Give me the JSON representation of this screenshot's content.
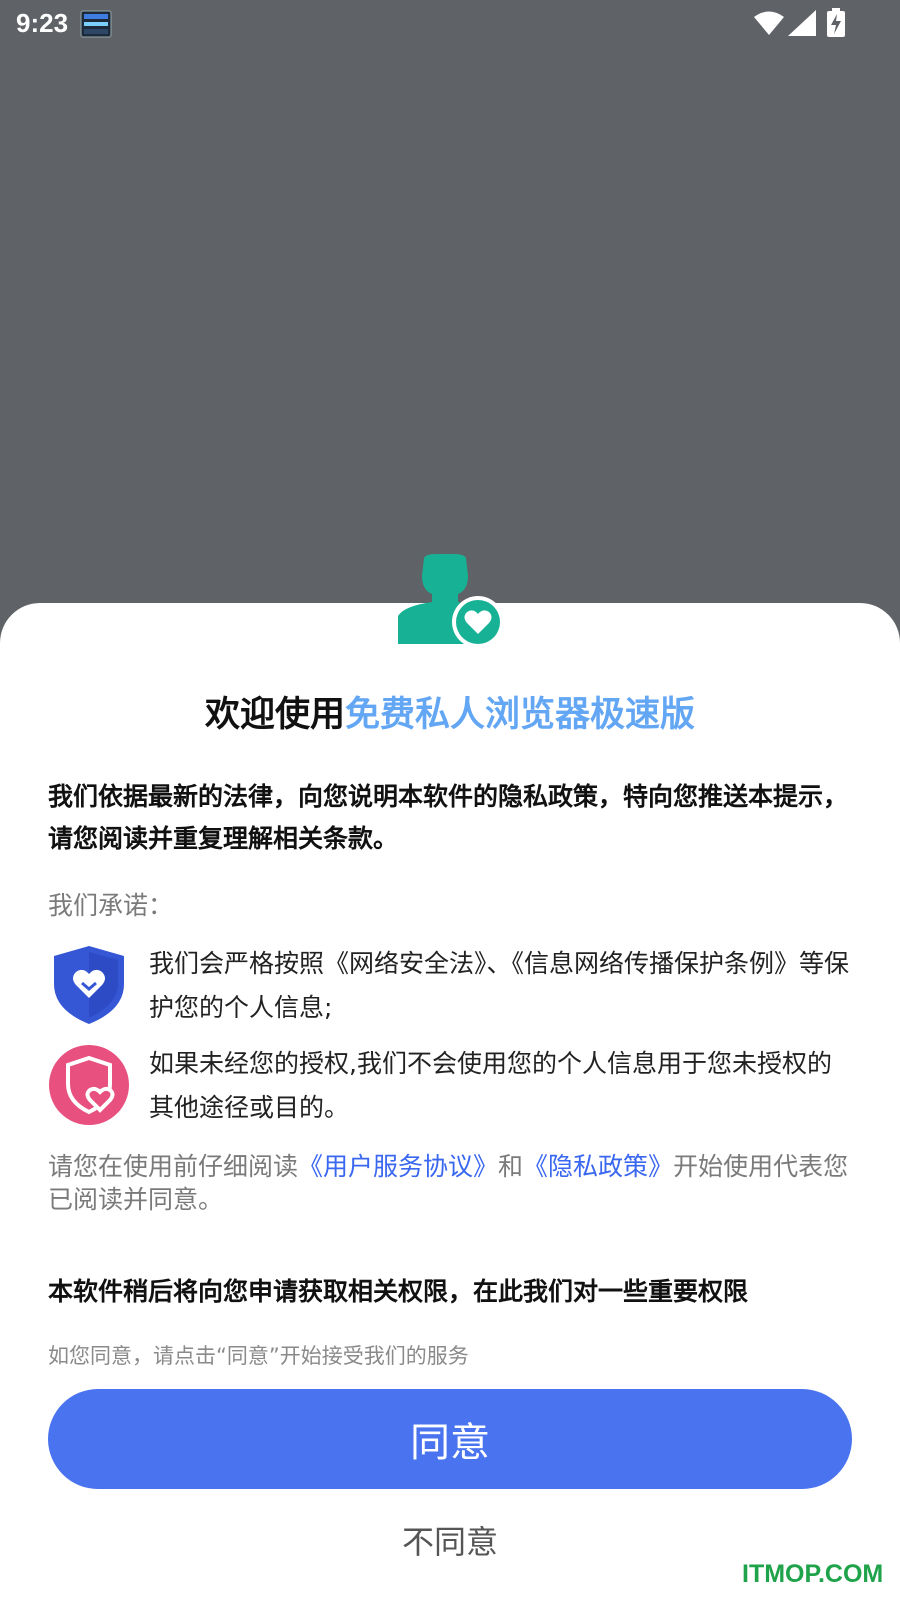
{
  "status_bar": {
    "time": "9:23"
  },
  "dialog": {
    "title_prefix": "欢迎使用",
    "title_app_name": "免费私人浏览器极速版",
    "intro": "我们依据最新的法律，向您说明本软件的隐私政策，特向您推送本提示，请您阅读并重复理解相关条款。",
    "promise_label": "我们承诺：",
    "promises": [
      {
        "icon": "shield-heart-icon",
        "text": "我们会严格按照《网络安全法》、《信息网络传播保护条例》等保护您的个人信息;"
      },
      {
        "icon": "pink-shield-heart-icon",
        "text": "如果未经您的授权,我们不会使用您的个人信息用于您未授权的其他途径或目的。"
      }
    ],
    "read_note": {
      "before": "请您在使用前仔细阅读",
      "user_agreement": "《用户服务协议》",
      "and": "和",
      "privacy_policy": "《隐私政策》",
      "after": "开始使用代表您已阅读并同意。"
    },
    "permission_note": "本软件稍后将向您申请获取相关权限，在此我们对一些重要权限",
    "agree_hint": "如您同意，请点击“同意”开始接受我们的服务",
    "agree_label": "同意",
    "disagree_label": "不同意"
  },
  "watermark": "ITMOP.COM",
  "colors": {
    "accent_blue": "#4a73f0",
    "title_highlight": "#62a6f4",
    "link_blue": "#3a67f0",
    "teal": "#17b295",
    "pink": "#e8507f",
    "shield_blue": "#3557d6"
  }
}
